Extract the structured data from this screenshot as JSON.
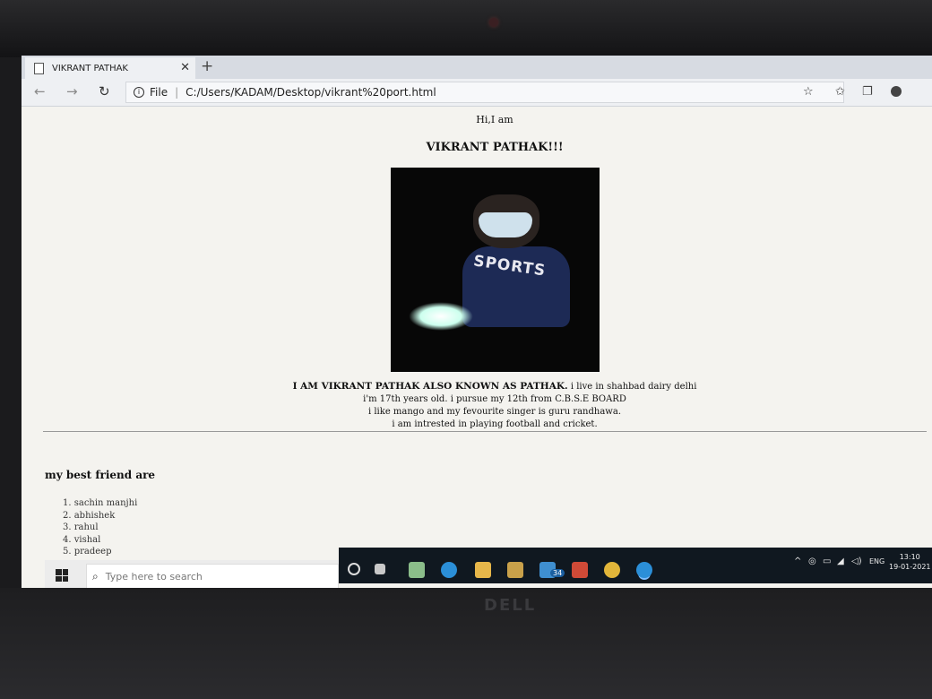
{
  "browser": {
    "tab_title": "VIKRANT PATHAK",
    "tab_close": "✕",
    "new_tab": "+",
    "back": "←",
    "forward": "→",
    "refresh": "↻",
    "info": "i",
    "file_label": "File",
    "separator": "|",
    "url": "C:/Users/KADAM/Desktop/vikrant%20port.html",
    "icons": [
      "star-icon",
      "favorites-icon",
      "collections-icon",
      "profile-icon"
    ]
  },
  "page": {
    "greeting": "Hi,I am",
    "name": "VIKRANT PATHAK!!!",
    "photo_text": "SPORTS",
    "bio_lead": "I AM VIKRANT PATHAK ALSO KNOWN AS PATHAK.",
    "bio_line1_rest": " i live in shahbad dairy delhi",
    "bio_line2": "i'm 17th years old. i pursue my 12th from C.B.S.E BOARD",
    "bio_line3": "i like mango and my fevourite singer is guru randhawa.",
    "bio_line4": "i am intrested in playing football and cricket.",
    "friends_heading": "my best friend are",
    "friends": [
      "1. sachin manjhi",
      "2. abhishek",
      "3. rahul",
      "4. vishal",
      "5. pradeep"
    ]
  },
  "taskbar": {
    "search_placeholder": "Type here to search",
    "search_icon": "⌕",
    "mail_badge": "34",
    "language": "ENG",
    "time": "13:10",
    "date": "19-01-2021",
    "chevron": "^",
    "icons": [
      "windows-icon",
      "cortana-icon",
      "task-view-icon",
      "photos-icon",
      "edge-icon",
      "file-explorer-icon",
      "store-icon",
      "mail-icon",
      "powerpoint-icon",
      "chrome-icon",
      "edge-active-icon"
    ]
  },
  "device": {
    "brand": "DELL"
  },
  "colors": {
    "taskbar_dark": "#101820",
    "page_bg": "#f4f3ef",
    "chrome_bg": "#eef0f3"
  }
}
